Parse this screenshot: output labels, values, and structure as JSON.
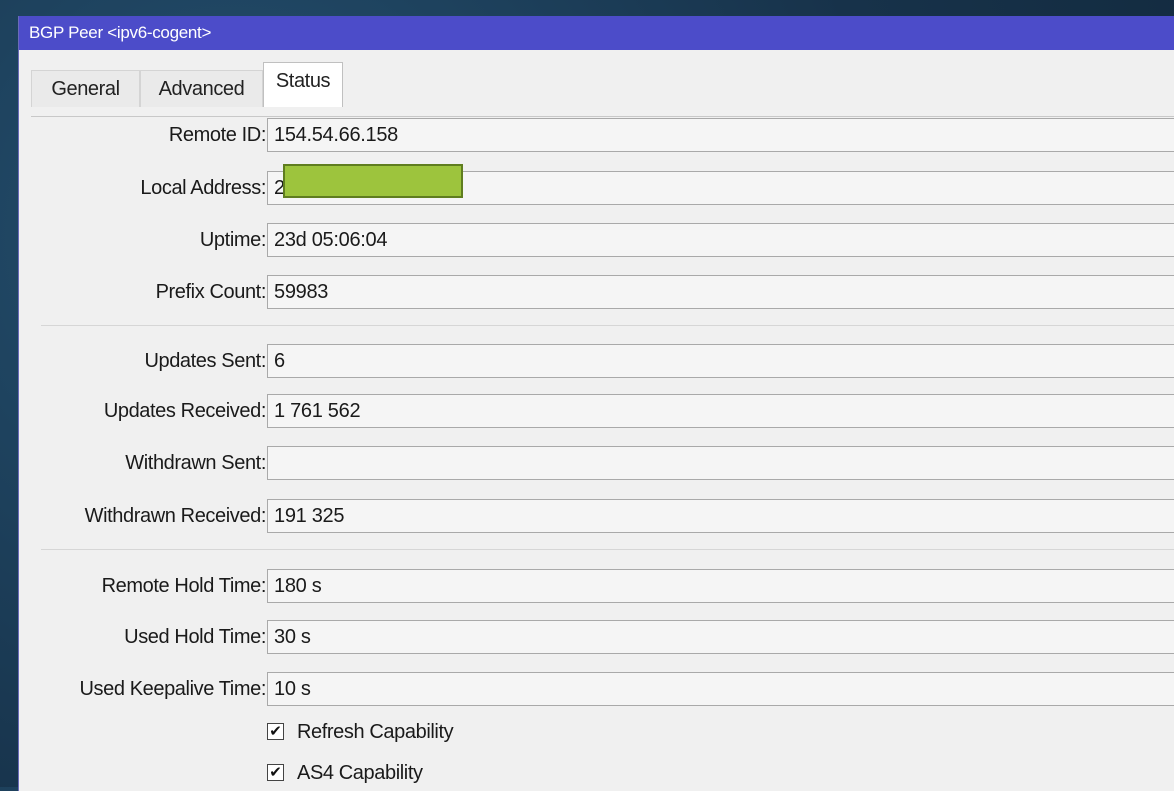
{
  "window": {
    "title": "BGP Peer <ipv6-cogent>"
  },
  "tabs": [
    {
      "label": "General",
      "active": false
    },
    {
      "label": "Advanced",
      "active": false
    },
    {
      "label": "Status",
      "active": true
    }
  ],
  "status": {
    "fields": [
      {
        "label": "Remote ID:",
        "value": "154.54.66.158"
      },
      {
        "label": "Local Address:",
        "value": "2"
      },
      {
        "label": "Uptime:",
        "value": "23d 05:06:04"
      },
      {
        "label": "Prefix Count:",
        "value": "59983"
      },
      {
        "label": "Updates Sent:",
        "value": "6"
      },
      {
        "label": "Updates Received:",
        "value": "1 761 562"
      },
      {
        "label": "Withdrawn Sent:",
        "value": ""
      },
      {
        "label": "Withdrawn Received:",
        "value": "191 325"
      },
      {
        "label": "Remote Hold Time:",
        "value": "180 s"
      },
      {
        "label": "Used Hold Time:",
        "value": "30 s"
      },
      {
        "label": "Used Keepalive Time:",
        "value": "10 s"
      }
    ],
    "checkboxes": [
      {
        "label": "Refresh Capability",
        "checked": true
      },
      {
        "label": "AS4 Capability",
        "checked": true
      }
    ],
    "check_glyph": "✔"
  },
  "colors": {
    "titlebar": "#4c4cc9",
    "redaction": "#9dc43d"
  }
}
